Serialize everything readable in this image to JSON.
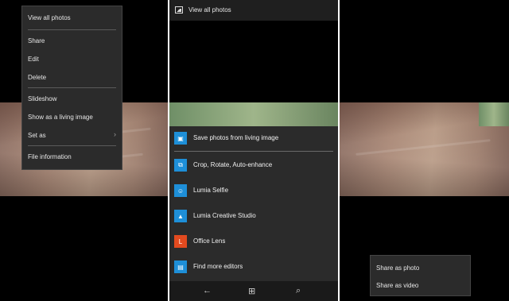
{
  "context_menu": {
    "items": [
      {
        "label": "View all photos"
      },
      {
        "label": "Share"
      },
      {
        "label": "Edit"
      },
      {
        "label": "Delete"
      },
      {
        "label": "Slideshow"
      },
      {
        "label": "Show as a living image"
      },
      {
        "label": "Set as"
      },
      {
        "label": "File information"
      }
    ]
  },
  "editor_screen": {
    "header_title": "View all photos",
    "sheet_items": [
      {
        "label": "Save photos from living image",
        "icon": "photo-icon"
      },
      {
        "label": "Crop, Rotate, Auto-enhance",
        "icon": "crop-icon"
      },
      {
        "label": "Lumia Selfie",
        "icon": "selfie-icon"
      },
      {
        "label": "Lumia Creative Studio",
        "icon": "creative-studio-icon"
      },
      {
        "label": "Office Lens",
        "icon": "office-lens-icon"
      },
      {
        "label": "Find more editors",
        "icon": "store-icon"
      }
    ],
    "nav": {
      "back": "←",
      "home": "⊞",
      "search": "⌕"
    }
  },
  "share_menu": {
    "items": [
      {
        "label": "Share as photo"
      },
      {
        "label": "Share as video"
      }
    ]
  },
  "colors": {
    "accent": "#1e8fd8",
    "office": "#e24a1f",
    "menu_bg": "#2b2b2b"
  }
}
